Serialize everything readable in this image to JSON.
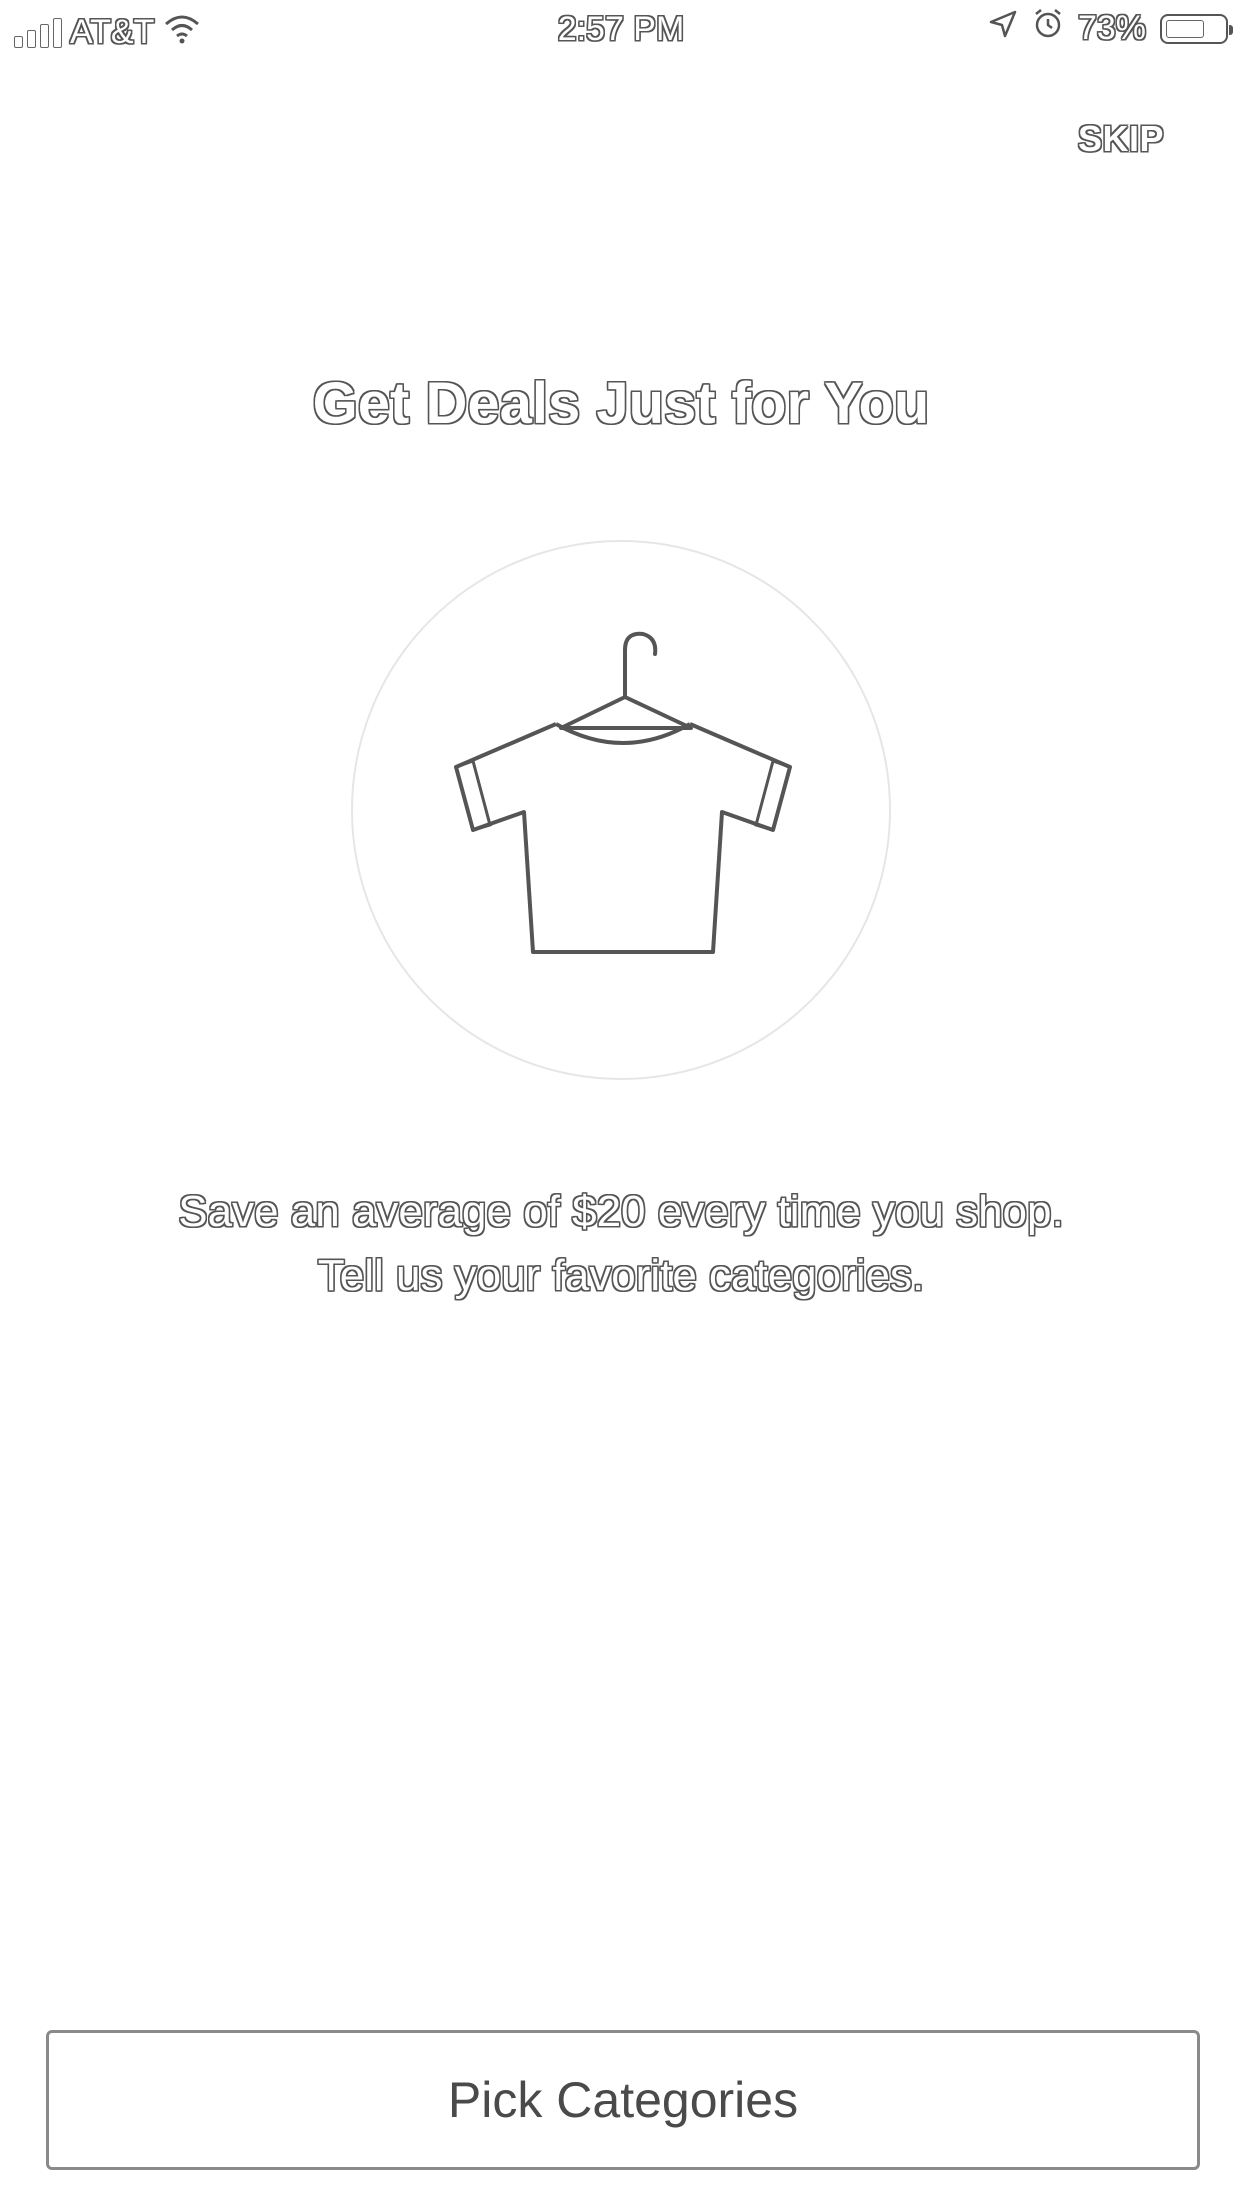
{
  "status_bar": {
    "carrier": "AT&T",
    "time": "2:57 PM",
    "battery_percent": "73%",
    "battery_level": 0.73,
    "icons": [
      "signal-icon",
      "wifi-icon",
      "location-icon",
      "alarm-icon",
      "battery-icon"
    ]
  },
  "header": {
    "skip_label": "SKIP"
  },
  "main": {
    "title": "Get Deals Just for You",
    "illustration_icon": "shirt-on-hanger-icon",
    "subtitle_line1": "Save an average of $20 every time you shop.",
    "subtitle_line2": "Tell us your favorite categories."
  },
  "footer": {
    "primary_button_label": "Pick Categories"
  },
  "colors": {
    "background": "#ffffff",
    "outline": "#555555",
    "button_border": "#8a8a8a",
    "circle_border": "#e6e6e6"
  }
}
